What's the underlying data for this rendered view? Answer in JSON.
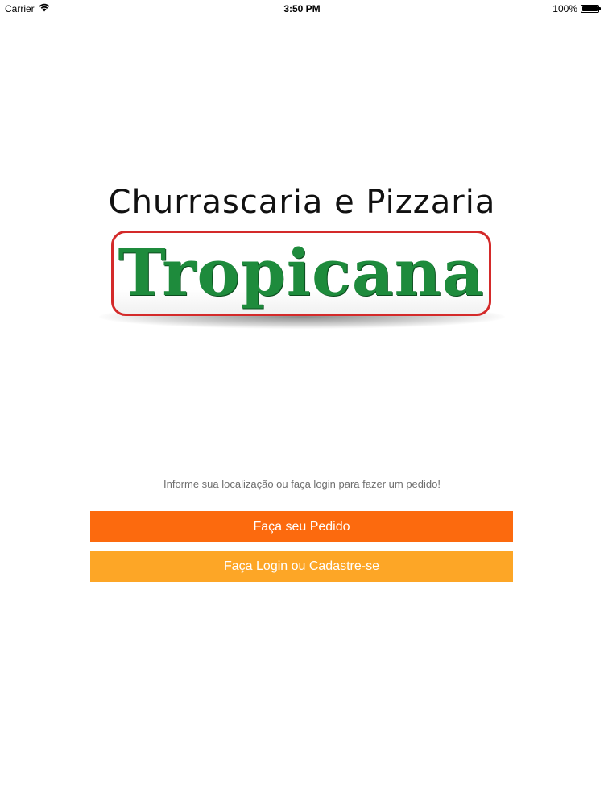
{
  "status_bar": {
    "carrier": "Carrier",
    "time": "3:50 PM",
    "battery": "100%",
    "battery_level": 1.0
  },
  "logo": {
    "subtitle": "Churrascaria e Pizzaria",
    "name": "Tropicana",
    "accent_color": "#d42a2a",
    "name_color": "#1e8b3c"
  },
  "prompt": "Informe sua localização ou faça login para fazer um pedido!",
  "buttons": {
    "order": "Faça seu Pedido",
    "login": "Faça Login ou Cadastre-se",
    "order_color": "#fc6a0e",
    "login_color": "#fda626"
  }
}
